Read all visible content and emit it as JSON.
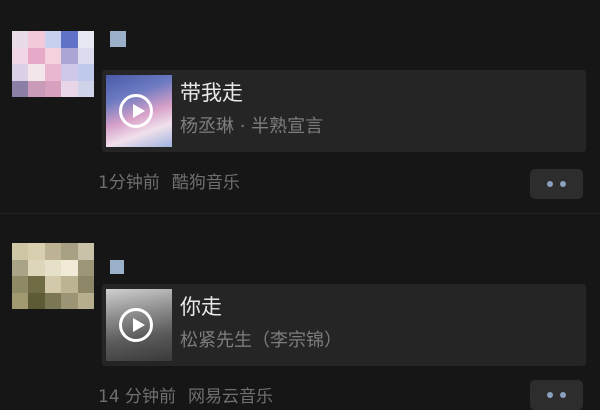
{
  "posts": [
    {
      "song_title": "带我走",
      "artist": "杨丞琳 · 半熟宣言",
      "time": "1分钟前",
      "source": "酷狗音乐"
    },
    {
      "song_title": "你走",
      "artist": "松紧先生（李宗锦）",
      "time": "14 分钟前",
      "source": "网易云音乐"
    }
  ],
  "colors": {
    "background": "#161616",
    "card": "#252525",
    "title_text": "#e9e9e9",
    "secondary_text": "#7d7d7d",
    "name_placeholder": "#9bb0c9"
  },
  "icons": {
    "play": "play-icon",
    "more": "more-dots-icon"
  }
}
